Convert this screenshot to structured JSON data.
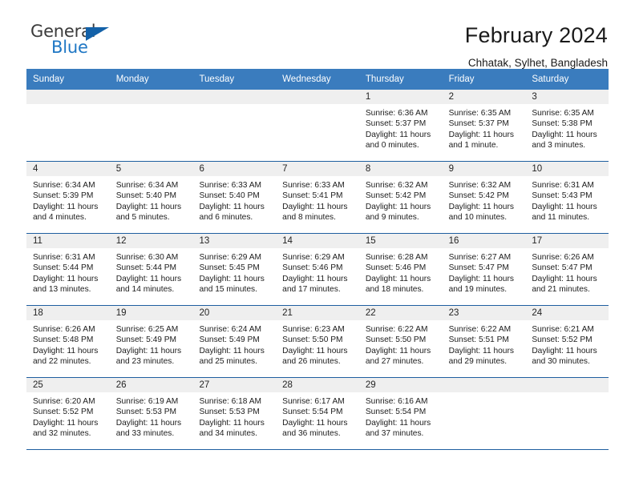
{
  "brand": {
    "line1": "General",
    "line2": "Blue",
    "triangle_icon": "brand-triangle-icon",
    "colors": {
      "general": "#3b3b3b",
      "blue": "#1f77c4",
      "triangle": "#1361a8"
    }
  },
  "header": {
    "title": "February 2024",
    "subtitle": "Chhatak, Sylhet, Bangladesh"
  },
  "theme": {
    "header_row_bg": "#3a7cbe",
    "day_head_bg": "#efefef",
    "week_divider": "#1f5fa0"
  },
  "weekday_headers": [
    "Sunday",
    "Monday",
    "Tuesday",
    "Wednesday",
    "Thursday",
    "Friday",
    "Saturday"
  ],
  "weeks": [
    [
      {
        "day": "",
        "sunrise": "",
        "sunset": "",
        "daylight": ""
      },
      {
        "day": "",
        "sunrise": "",
        "sunset": "",
        "daylight": ""
      },
      {
        "day": "",
        "sunrise": "",
        "sunset": "",
        "daylight": ""
      },
      {
        "day": "",
        "sunrise": "",
        "sunset": "",
        "daylight": ""
      },
      {
        "day": "1",
        "sunrise": "Sunrise: 6:36 AM",
        "sunset": "Sunset: 5:37 PM",
        "daylight": "Daylight: 11 hours and 0 minutes."
      },
      {
        "day": "2",
        "sunrise": "Sunrise: 6:35 AM",
        "sunset": "Sunset: 5:37 PM",
        "daylight": "Daylight: 11 hours and 1 minute."
      },
      {
        "day": "3",
        "sunrise": "Sunrise: 6:35 AM",
        "sunset": "Sunset: 5:38 PM",
        "daylight": "Daylight: 11 hours and 3 minutes."
      }
    ],
    [
      {
        "day": "4",
        "sunrise": "Sunrise: 6:34 AM",
        "sunset": "Sunset: 5:39 PM",
        "daylight": "Daylight: 11 hours and 4 minutes."
      },
      {
        "day": "5",
        "sunrise": "Sunrise: 6:34 AM",
        "sunset": "Sunset: 5:40 PM",
        "daylight": "Daylight: 11 hours and 5 minutes."
      },
      {
        "day": "6",
        "sunrise": "Sunrise: 6:33 AM",
        "sunset": "Sunset: 5:40 PM",
        "daylight": "Daylight: 11 hours and 6 minutes."
      },
      {
        "day": "7",
        "sunrise": "Sunrise: 6:33 AM",
        "sunset": "Sunset: 5:41 PM",
        "daylight": "Daylight: 11 hours and 8 minutes."
      },
      {
        "day": "8",
        "sunrise": "Sunrise: 6:32 AM",
        "sunset": "Sunset: 5:42 PM",
        "daylight": "Daylight: 11 hours and 9 minutes."
      },
      {
        "day": "9",
        "sunrise": "Sunrise: 6:32 AM",
        "sunset": "Sunset: 5:42 PM",
        "daylight": "Daylight: 11 hours and 10 minutes."
      },
      {
        "day": "10",
        "sunrise": "Sunrise: 6:31 AM",
        "sunset": "Sunset: 5:43 PM",
        "daylight": "Daylight: 11 hours and 11 minutes."
      }
    ],
    [
      {
        "day": "11",
        "sunrise": "Sunrise: 6:31 AM",
        "sunset": "Sunset: 5:44 PM",
        "daylight": "Daylight: 11 hours and 13 minutes."
      },
      {
        "day": "12",
        "sunrise": "Sunrise: 6:30 AM",
        "sunset": "Sunset: 5:44 PM",
        "daylight": "Daylight: 11 hours and 14 minutes."
      },
      {
        "day": "13",
        "sunrise": "Sunrise: 6:29 AM",
        "sunset": "Sunset: 5:45 PM",
        "daylight": "Daylight: 11 hours and 15 minutes."
      },
      {
        "day": "14",
        "sunrise": "Sunrise: 6:29 AM",
        "sunset": "Sunset: 5:46 PM",
        "daylight": "Daylight: 11 hours and 17 minutes."
      },
      {
        "day": "15",
        "sunrise": "Sunrise: 6:28 AM",
        "sunset": "Sunset: 5:46 PM",
        "daylight": "Daylight: 11 hours and 18 minutes."
      },
      {
        "day": "16",
        "sunrise": "Sunrise: 6:27 AM",
        "sunset": "Sunset: 5:47 PM",
        "daylight": "Daylight: 11 hours and 19 minutes."
      },
      {
        "day": "17",
        "sunrise": "Sunrise: 6:26 AM",
        "sunset": "Sunset: 5:47 PM",
        "daylight": "Daylight: 11 hours and 21 minutes."
      }
    ],
    [
      {
        "day": "18",
        "sunrise": "Sunrise: 6:26 AM",
        "sunset": "Sunset: 5:48 PM",
        "daylight": "Daylight: 11 hours and 22 minutes."
      },
      {
        "day": "19",
        "sunrise": "Sunrise: 6:25 AM",
        "sunset": "Sunset: 5:49 PM",
        "daylight": "Daylight: 11 hours and 23 minutes."
      },
      {
        "day": "20",
        "sunrise": "Sunrise: 6:24 AM",
        "sunset": "Sunset: 5:49 PM",
        "daylight": "Daylight: 11 hours and 25 minutes."
      },
      {
        "day": "21",
        "sunrise": "Sunrise: 6:23 AM",
        "sunset": "Sunset: 5:50 PM",
        "daylight": "Daylight: 11 hours and 26 minutes."
      },
      {
        "day": "22",
        "sunrise": "Sunrise: 6:22 AM",
        "sunset": "Sunset: 5:50 PM",
        "daylight": "Daylight: 11 hours and 27 minutes."
      },
      {
        "day": "23",
        "sunrise": "Sunrise: 6:22 AM",
        "sunset": "Sunset: 5:51 PM",
        "daylight": "Daylight: 11 hours and 29 minutes."
      },
      {
        "day": "24",
        "sunrise": "Sunrise: 6:21 AM",
        "sunset": "Sunset: 5:52 PM",
        "daylight": "Daylight: 11 hours and 30 minutes."
      }
    ],
    [
      {
        "day": "25",
        "sunrise": "Sunrise: 6:20 AM",
        "sunset": "Sunset: 5:52 PM",
        "daylight": "Daylight: 11 hours and 32 minutes."
      },
      {
        "day": "26",
        "sunrise": "Sunrise: 6:19 AM",
        "sunset": "Sunset: 5:53 PM",
        "daylight": "Daylight: 11 hours and 33 minutes."
      },
      {
        "day": "27",
        "sunrise": "Sunrise: 6:18 AM",
        "sunset": "Sunset: 5:53 PM",
        "daylight": "Daylight: 11 hours and 34 minutes."
      },
      {
        "day": "28",
        "sunrise": "Sunrise: 6:17 AM",
        "sunset": "Sunset: 5:54 PM",
        "daylight": "Daylight: 11 hours and 36 minutes."
      },
      {
        "day": "29",
        "sunrise": "Sunrise: 6:16 AM",
        "sunset": "Sunset: 5:54 PM",
        "daylight": "Daylight: 11 hours and 37 minutes."
      },
      {
        "day": "",
        "sunrise": "",
        "sunset": "",
        "daylight": ""
      },
      {
        "day": "",
        "sunrise": "",
        "sunset": "",
        "daylight": ""
      }
    ]
  ]
}
